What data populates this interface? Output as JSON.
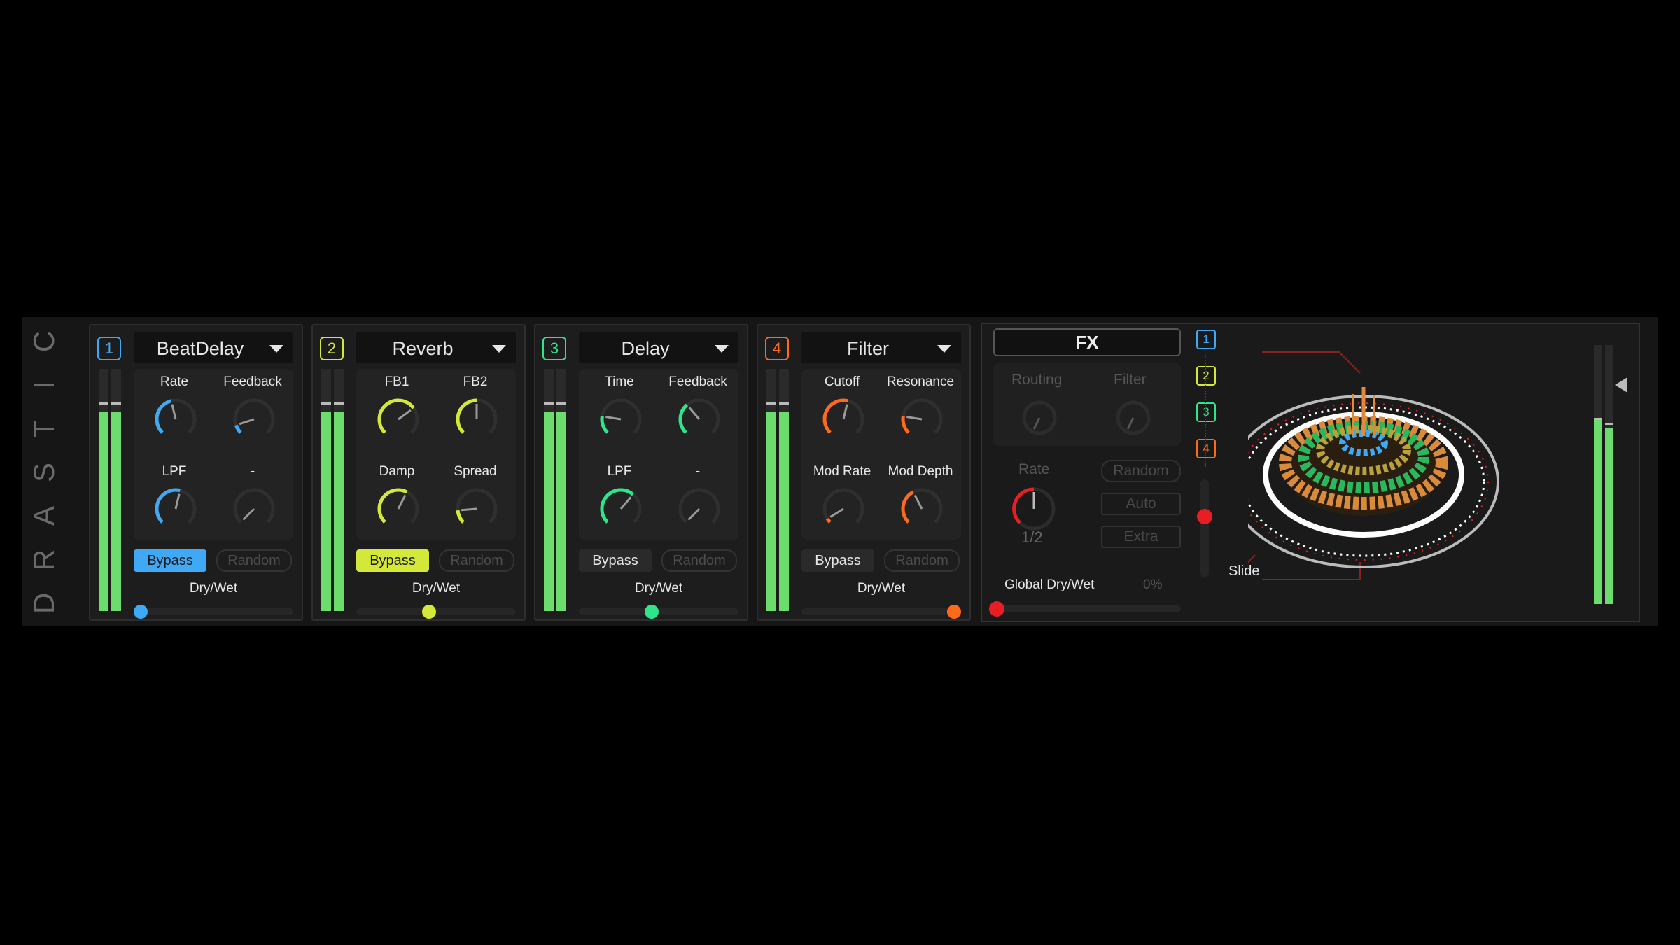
{
  "brand": "DRASTIC",
  "colors": {
    "blue": "#3fa9f5",
    "yellow": "#d4e83a",
    "green": "#2ee58a",
    "orange": "#ff6a1a",
    "red": "#e81e25",
    "meter_green": "#6cdc6c"
  },
  "slots": [
    {
      "number": "1",
      "name": "BeatDelay",
      "accent": "#3fa9f5",
      "knobs": [
        {
          "label": "Rate",
          "value": 0.45
        },
        {
          "label": "Feedback",
          "value": 0.1
        },
        {
          "label": "LPF",
          "value": 0.55
        },
        {
          "label": "-",
          "value": 0.0
        }
      ],
      "bypass_label": "Bypass",
      "bypass_active": true,
      "random_label": "Random",
      "drywet_label": "Dry/Wet",
      "drywet": 0.0
    },
    {
      "number": "2",
      "name": "Reverb",
      "accent": "#d4e83a",
      "knobs": [
        {
          "label": "FB1",
          "value": 0.7
        },
        {
          "label": "FB2",
          "value": 0.5
        },
        {
          "label": "Damp",
          "value": 0.6
        },
        {
          "label": "Spread",
          "value": 0.15
        }
      ],
      "bypass_label": "Bypass",
      "bypass_active": true,
      "random_label": "Random",
      "drywet_label": "Dry/Wet",
      "drywet": 0.45
    },
    {
      "number": "3",
      "name": "Delay",
      "accent": "#2ee58a",
      "knobs": [
        {
          "label": "Time",
          "value": 0.2
        },
        {
          "label": "Feedback",
          "value": 0.35
        },
        {
          "label": "LPF",
          "value": 0.65
        },
        {
          "label": "-",
          "value": 0.0
        }
      ],
      "bypass_label": "Bypass",
      "bypass_active": false,
      "random_label": "Random",
      "drywet_label": "Dry/Wet",
      "drywet": 0.45
    },
    {
      "number": "4",
      "name": "Filter",
      "accent": "#ff6a1a",
      "knobs": [
        {
          "label": "Cutoff",
          "value": 0.55
        },
        {
          "label": "Resonance",
          "value": 0.2
        },
        {
          "label": "Mod Rate",
          "value": 0.05
        },
        {
          "label": "Mod Depth",
          "value": 0.4
        }
      ],
      "bypass_label": "Bypass",
      "bypass_active": false,
      "random_label": "Random",
      "drywet_label": "Dry/Wet",
      "drywet": 1.0
    }
  ],
  "fx": {
    "title": "FX",
    "routing_label": "Routing",
    "filter_label": "Filter",
    "rate_label": "Rate",
    "rate_value": "1/2",
    "random_label": "Random",
    "auto_label": "Auto",
    "extra_label": "Extra",
    "global_label": "Global Dry/Wet",
    "global_value": "0%",
    "slide_label": "Slide",
    "route_numbers": [
      "1",
      "2",
      "3",
      "4"
    ]
  }
}
